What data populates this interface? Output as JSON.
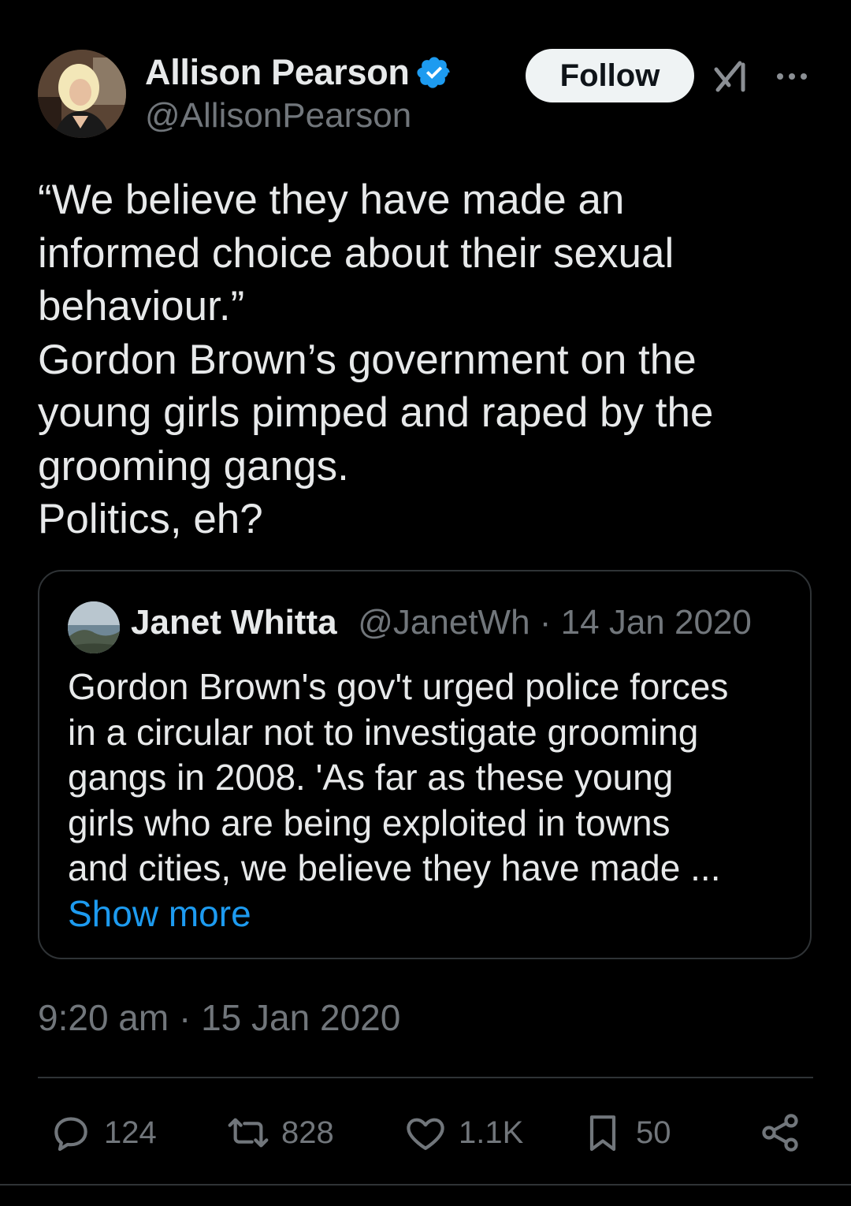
{
  "author": {
    "name": "Allison Pearson",
    "handle": "@AllisonPearson"
  },
  "follow_label": "Follow",
  "tweet_lines": [
    "“We believe they have made an",
    "informed choice about their sexual",
    "behaviour.”",
    "Gordon Brown’s government on the",
    "young girls pimped and raped by the",
    "grooming gangs.",
    "Politics, eh?"
  ],
  "quote": {
    "name": "Janet Whitta",
    "handle": "@JanetWh",
    "date": "· 14 Jan 2020",
    "lines": [
      "Gordon Brown's gov't urged police forces",
      "in a circular not to investigate grooming",
      "gangs in 2008.  'As far as these young",
      "girls who are being exploited in towns",
      "and cities, we believe they have made ..."
    ],
    "show_more": "Show more"
  },
  "timestamp": "9:20 am · 15 Jan 2020",
  "metrics": {
    "replies": "124",
    "reposts": "828",
    "likes": "1.1K",
    "bookmarks": "50"
  },
  "colors": {
    "background": "#000000",
    "text": "#e7e9ea",
    "secondary": "#71767b",
    "link": "#1d9bf0",
    "verified": "#1d9bf0",
    "border": "#2f3336"
  }
}
